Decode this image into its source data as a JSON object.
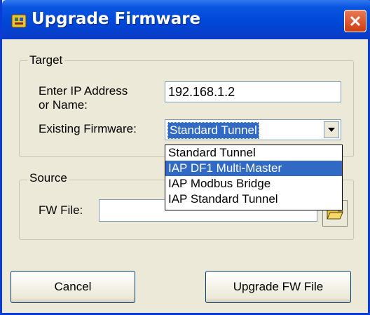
{
  "window": {
    "title": "Upgrade Firmware"
  },
  "target": {
    "group_label": "Target",
    "ip_label_line1": "Enter IP Address",
    "ip_label_line2": "or Name:",
    "ip_value": "192.168.1.2",
    "firmware_label": "Existing Firmware:",
    "firmware_selected": "Standard Tunnel",
    "firmware_options": [
      "Standard Tunnel",
      "IAP DF1 Multi-Master",
      "IAP Modbus Bridge",
      "IAP Standard Tunnel"
    ],
    "highlighted_option": "IAP DF1 Multi-Master"
  },
  "source": {
    "group_label": "Source",
    "fw_label": "FW File:",
    "fw_value": ""
  },
  "buttons": {
    "cancel": "Cancel",
    "upgrade": "Upgrade FW File"
  },
  "colors": {
    "title_bar": "#0048d8",
    "selection": "#316ac5",
    "close_button": "#cf3c12",
    "dialog_bg": "#ece9d8"
  },
  "icons": {
    "app": "firmware-app-icon",
    "close": "close-icon",
    "combo_arrow": "chevron-down-icon",
    "browse": "folder-icon"
  }
}
